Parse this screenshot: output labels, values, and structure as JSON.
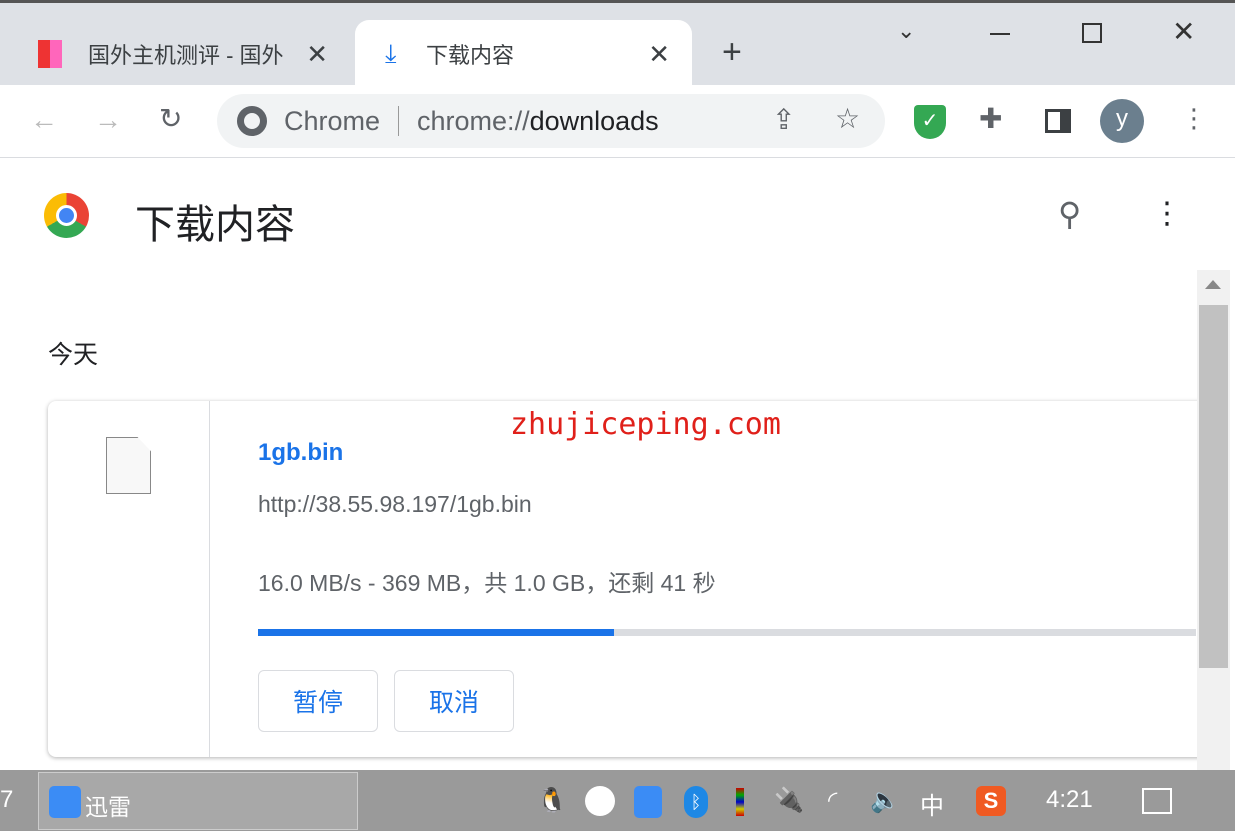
{
  "tabs": [
    {
      "title": "国外主机测评 - 国外",
      "icon": "site-favicon"
    },
    {
      "title": "下载内容",
      "icon": "download-icon",
      "active": true
    }
  ],
  "omnibox": {
    "origin": "Chrome",
    "url_prefix": "chrome://",
    "url_path": "downloads"
  },
  "page": {
    "title": "下载内容",
    "section": "今天"
  },
  "download": {
    "filename": "1gb.bin",
    "url": "http://38.55.98.197/1gb.bin",
    "status": "16.0 MB/s - 369 MB，共 1.0 GB，还剩 41 秒",
    "progress": 0.38,
    "pause_label": "暂停",
    "cancel_label": "取消"
  },
  "watermark": "zhujiceping.com",
  "taskbar": {
    "left_fragment": "7",
    "app": "迅雷",
    "ime": "中",
    "clock": "4:21"
  },
  "colors": {
    "accent": "#1a73e8",
    "watermark": "#e0201a"
  }
}
